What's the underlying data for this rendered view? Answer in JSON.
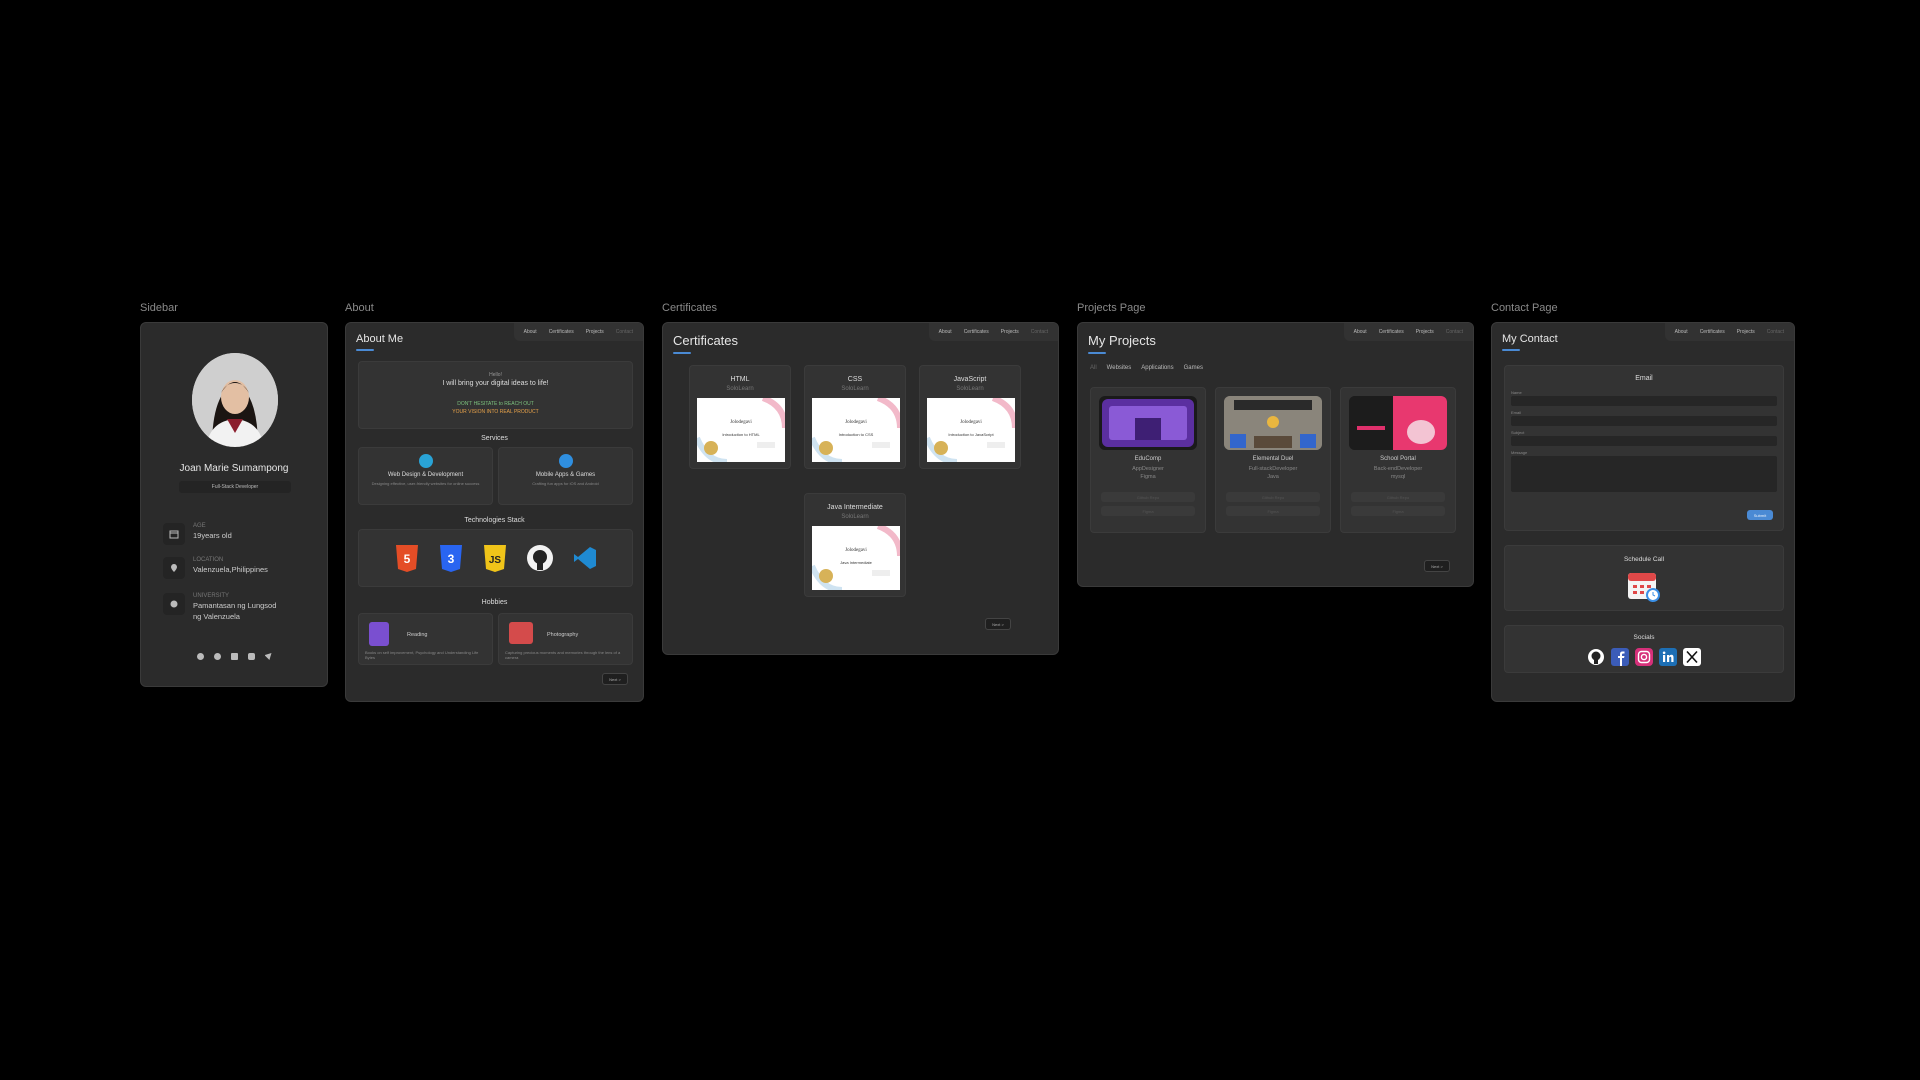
{
  "frame_labels": {
    "sidebar": "Sidebar",
    "about": "About",
    "certificates": "Certificates",
    "projects": "Projects Page",
    "contact": "Contact Page"
  },
  "nav": {
    "about": "About",
    "certificates": "Certificates",
    "projects": "Projects",
    "contact": "Contact"
  },
  "sidebar": {
    "name": "Joan Marie Sumampong",
    "role": "Full-Stack Developer",
    "info": [
      {
        "label": "AGE",
        "value": "19years old",
        "icon": "calendar-icon"
      },
      {
        "label": "LOCATION",
        "value": "Valenzuela,Philippines",
        "icon": "location-pin-icon"
      },
      {
        "label": "UNIVERSITY",
        "value": "Pamantasan ng Lungsod ng Valenzuela",
        "icon": "school-icon"
      }
    ],
    "socials": [
      "facebook-icon",
      "github-icon",
      "linkedin-icon",
      "instagram-icon",
      "twitter-icon"
    ]
  },
  "about": {
    "title": "About Me",
    "hero_small": "Hello!",
    "hero_main": "I will bring your digital ideas to life!",
    "cta1": "DON'T HESITATE to REACH OUT",
    "cta2": "YOUR VISION INTO REAL PRODUCT",
    "services_title": "Services",
    "services": [
      {
        "title": "Web Design & Development",
        "desc": "Designing effective, user-friendly websites for online success"
      },
      {
        "title": "Mobile Apps & Games",
        "desc": "Crafting fun apps for iOS and Android"
      }
    ],
    "tech_title": "Technologies Stack",
    "tech": [
      "html5-icon",
      "css3-icon",
      "javascript-icon",
      "github-icon",
      "vscode-icon"
    ],
    "hobbies_title": "Hobbies",
    "hobbies": [
      {
        "title": "Reading",
        "desc": "Books on self improvement, Psychology and Understanding Life Bytes"
      },
      {
        "title": "Photography",
        "desc": "Capturing precious moments and memories through the lens of a camera"
      }
    ],
    "next": "Next >"
  },
  "certificates": {
    "title": "Certificates",
    "items": [
      {
        "name": "HTML",
        "issuer": "SoloLearn",
        "course": "Introduction to HTML"
      },
      {
        "name": "CSS",
        "issuer": "SoloLearn",
        "course": "Introduction to CSS"
      },
      {
        "name": "JavaScript",
        "issuer": "SoloLearn",
        "course": "Introduction to JavaScript"
      },
      {
        "name": "Java Intermediate",
        "issuer": "SoloLearn",
        "course": "Java Intermediate"
      }
    ],
    "cert_holder": "Jolodegavi",
    "next": "Next >"
  },
  "projects": {
    "title": "My Projects",
    "filters": [
      "All",
      "Websites",
      "Applications",
      "Games"
    ],
    "items": [
      {
        "name": "EduComp",
        "role": "AppDesigner",
        "tool": "Figma",
        "btn1": "Github Repo",
        "btn2": "Figma"
      },
      {
        "name": "Elemental Duel",
        "role": "Full-stackDeveloper",
        "tool": "Java",
        "btn1": "Github Repo",
        "btn2": "Figma"
      },
      {
        "name": "School Portal",
        "role": "Back-endDeveloper",
        "tool": "mysql",
        "btn1": "Github Repo",
        "btn2": "Figma"
      }
    ],
    "next": "Next >"
  },
  "contact": {
    "title": "My Contact",
    "email_title": "Email",
    "fields": [
      "Name",
      "Email",
      "Subject",
      "Message"
    ],
    "submit": "Submit",
    "schedule_title": "Schedule Call",
    "socials_title": "Socials",
    "socials": [
      "github-icon",
      "facebook-icon",
      "instagram-icon",
      "linkedin-icon",
      "x-icon"
    ]
  },
  "colors": {
    "accent": "#4a8ad4",
    "panel": "#2b2b2b",
    "card": "#333333",
    "background": "#000000"
  }
}
